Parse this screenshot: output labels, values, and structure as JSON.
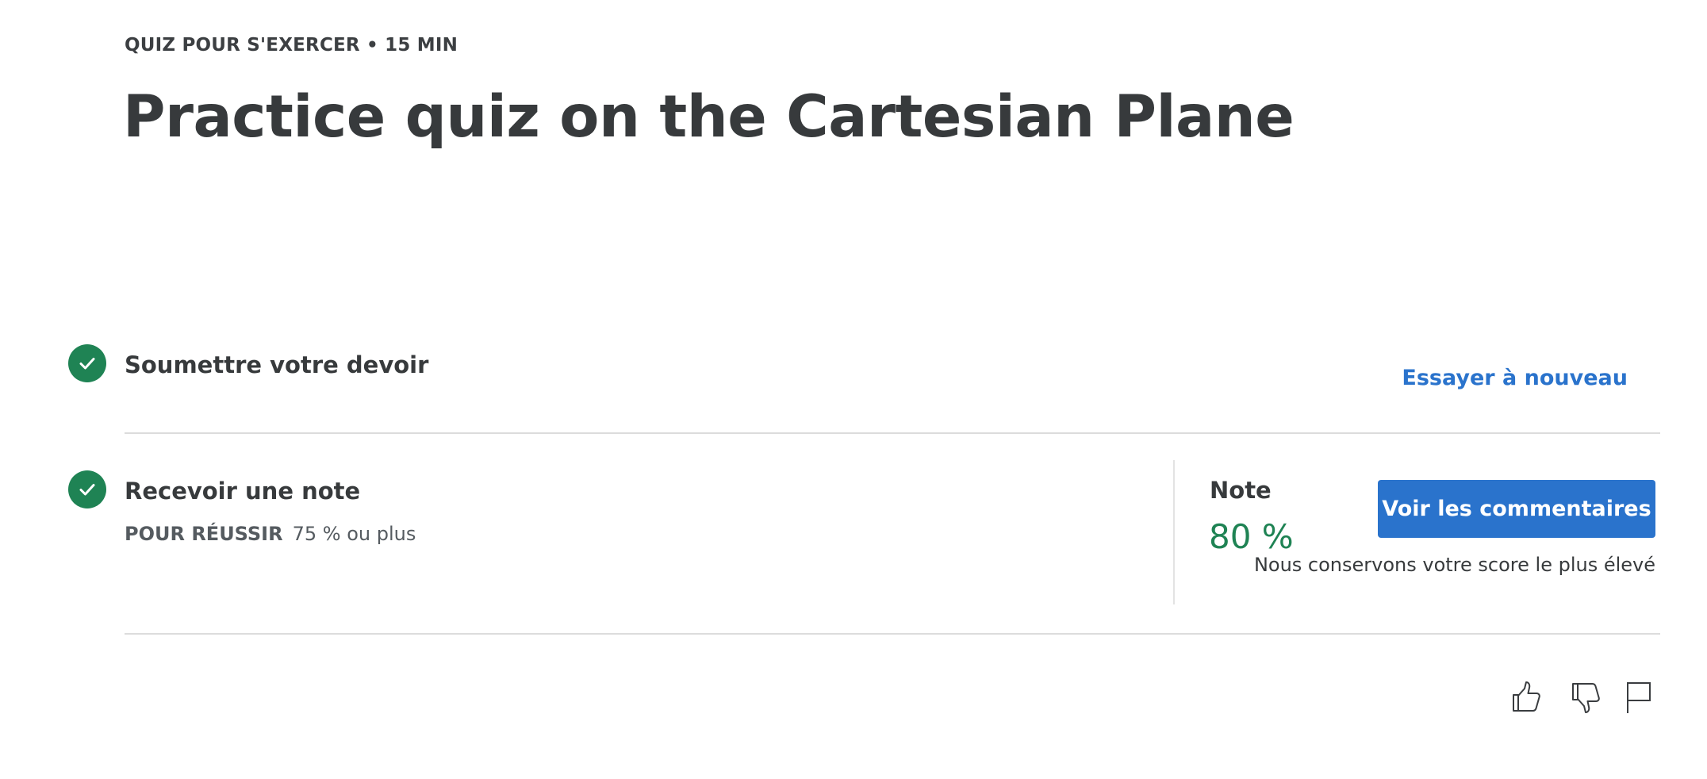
{
  "header": {
    "eyebrow": "QUIZ POUR S'EXERCER • 15  MIN",
    "title": "Practice quiz on the Cartesian Plane"
  },
  "steps": {
    "submit": {
      "title": "Soumettre votre devoir",
      "action_label": "Essayer à nouveau",
      "status_icon": "check-circle-icon"
    },
    "grade": {
      "title": "Recevoir une note",
      "pass_label": "POUR RÉUSSIR",
      "pass_value": "75 % ou plus",
      "status_icon": "check-circle-icon"
    }
  },
  "grade": {
    "label": "Note",
    "value": "80 %",
    "feedback_button": "Voir les commentaires",
    "note": "Nous conservons votre score le plus élevé"
  },
  "feedback_icons": [
    "thumbs-up-icon",
    "thumbs-down-icon",
    "flag-icon"
  ],
  "colors": {
    "success": "#1f8354",
    "accent": "#2a73cc",
    "text": "#373a3c"
  }
}
